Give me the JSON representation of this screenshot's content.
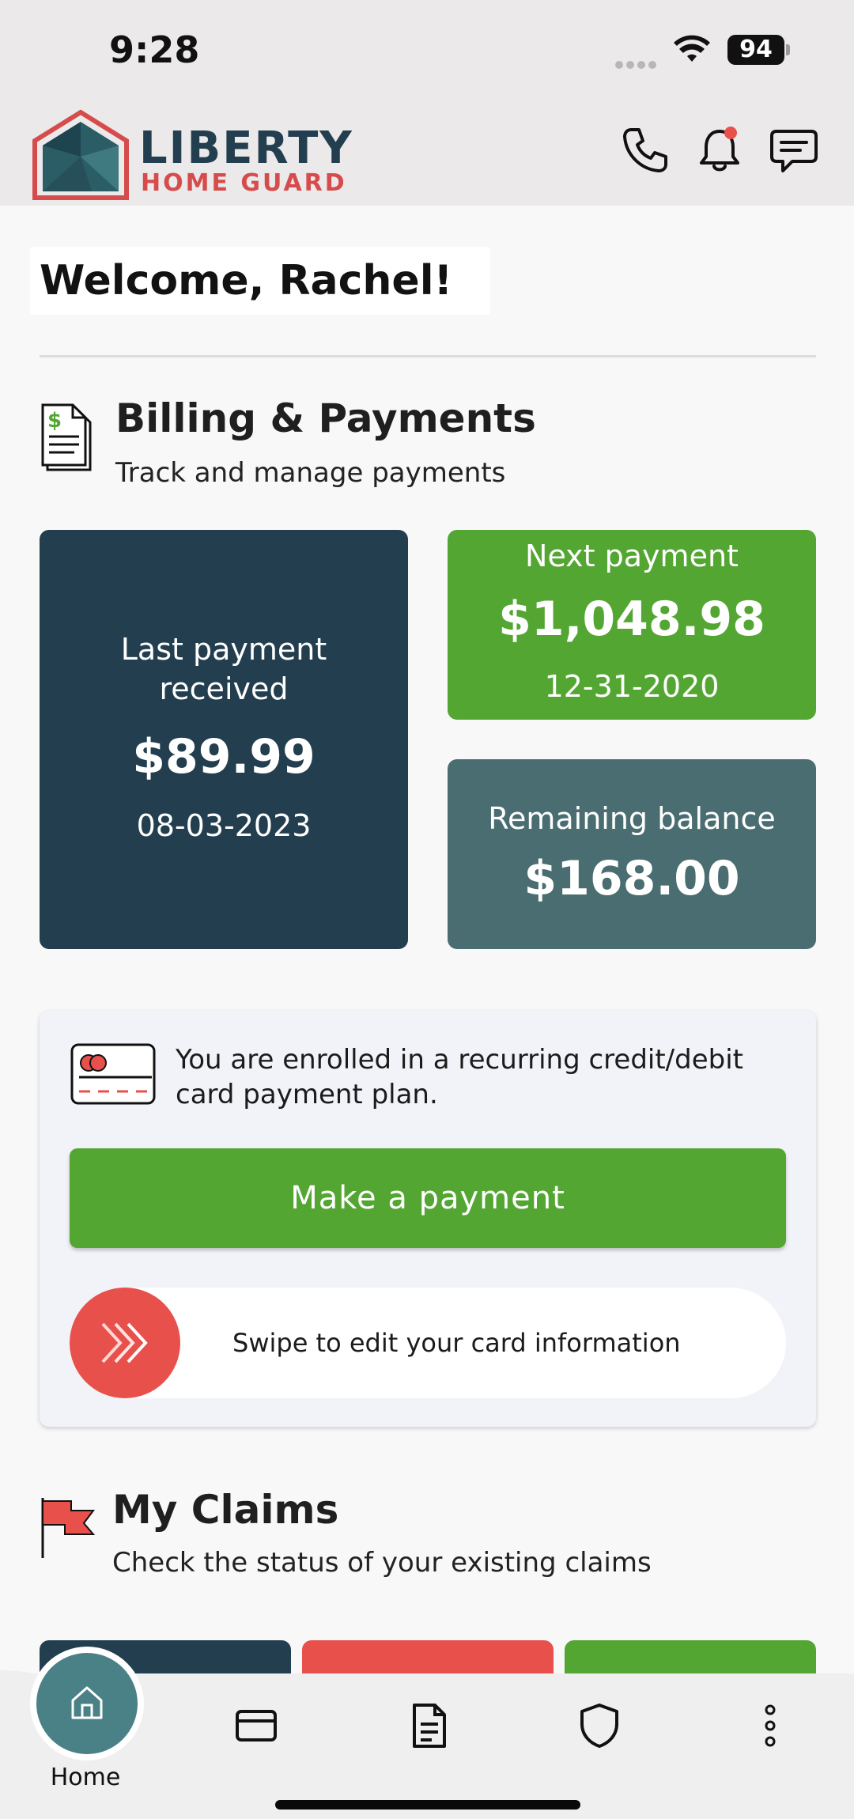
{
  "status_bar": {
    "time": "9:28",
    "battery": "94"
  },
  "header": {
    "logo_title": "LIBERTY",
    "logo_subtitle": "HOME GUARD",
    "icons": [
      "phone-icon",
      "bell-icon",
      "chat-icon"
    ]
  },
  "welcome": {
    "text": "Welcome, Rachel!"
  },
  "billing": {
    "title": "Billing & Payments",
    "subtitle": "Track and manage payments",
    "last_payment": {
      "label": "Last payment received",
      "amount": "$89.99",
      "date": "08-03-2023"
    },
    "next_payment": {
      "label": "Next payment",
      "amount": "$1,048.98",
      "date": "12-31-2020"
    },
    "remaining_balance": {
      "label": "Remaining balance",
      "amount": "$168.00"
    },
    "enrollment_text": "You are enrolled in a recurring credit/debit card payment plan.",
    "make_payment_label": "Make a payment",
    "swipe_label": "Swipe to edit your card information"
  },
  "claims": {
    "title": "My Claims",
    "subtitle": "Check the status of your existing claims"
  },
  "bottom_nav": {
    "home_label": "Home",
    "items": [
      "home-icon",
      "card-icon",
      "document-icon",
      "shield-icon",
      "more-icon"
    ]
  },
  "colors": {
    "navy": "#233e4e",
    "green": "#54a632",
    "teal": "#4a6d71",
    "red": "#e8504b"
  }
}
